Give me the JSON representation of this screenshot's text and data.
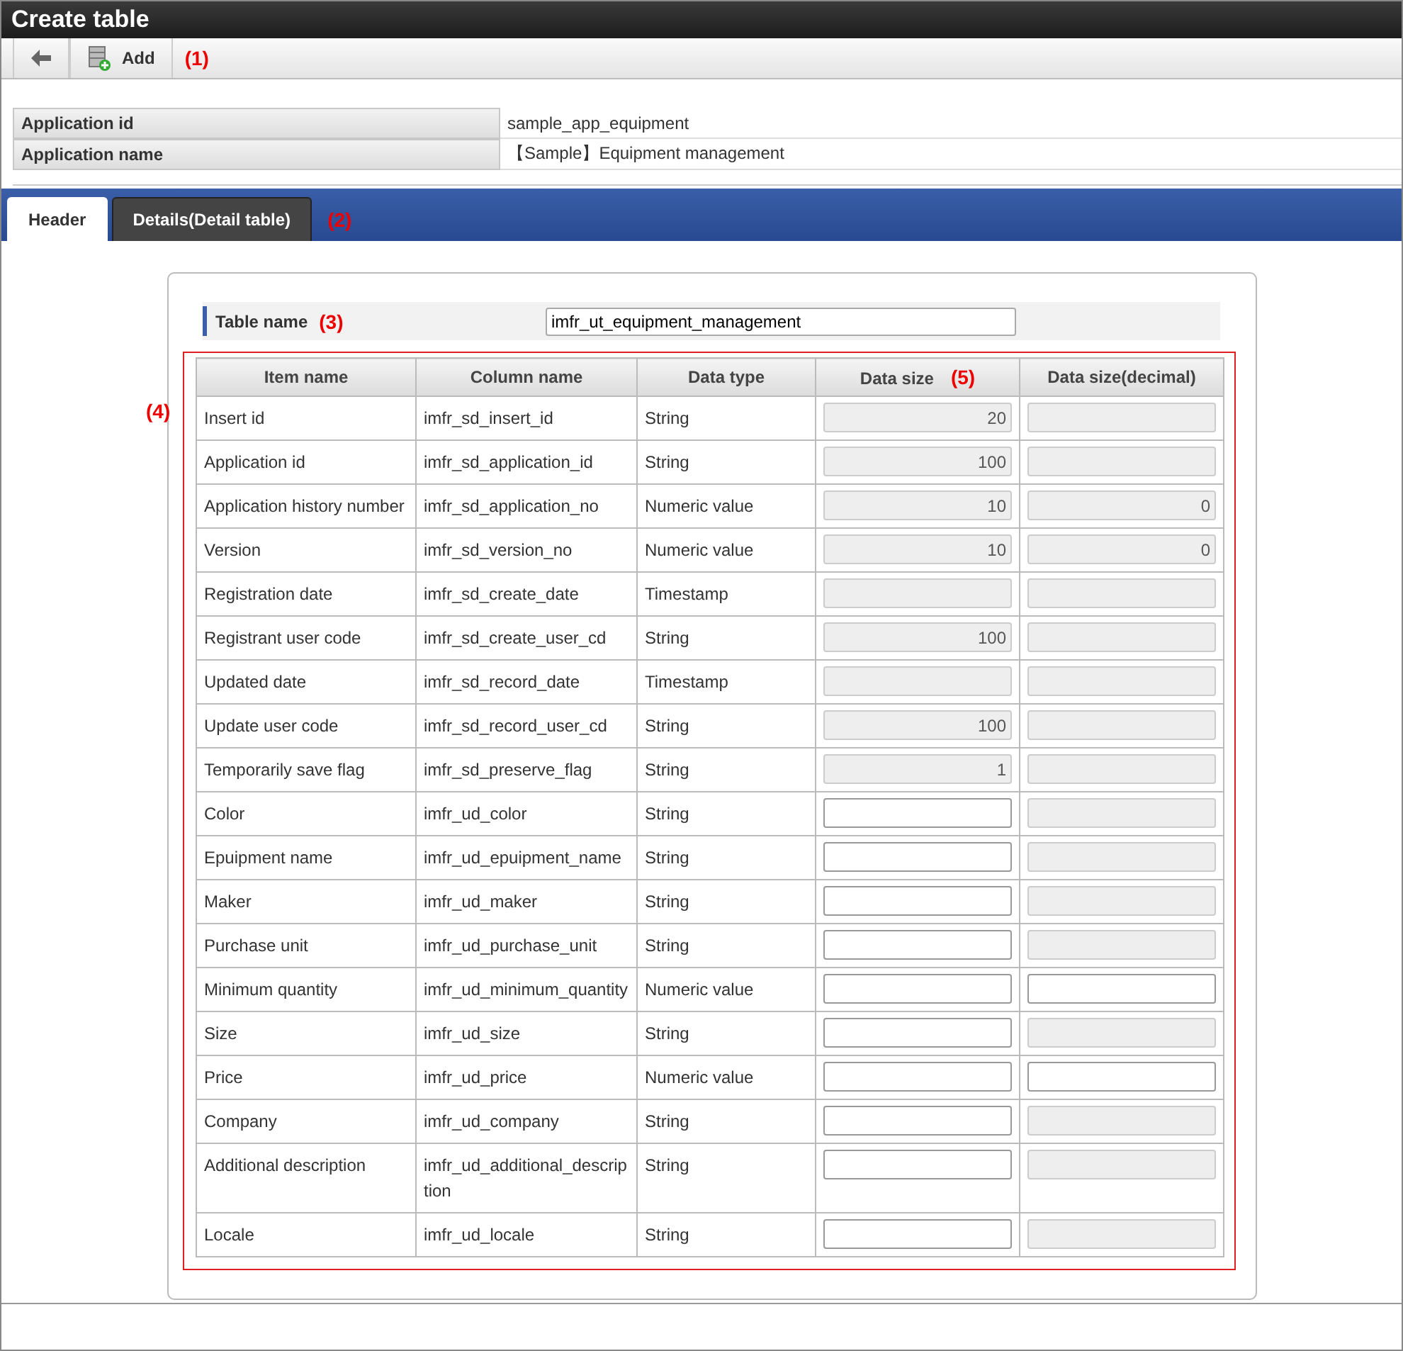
{
  "window": {
    "title": "Create table"
  },
  "toolbar": {
    "buttons": [
      {
        "kind": "back"
      },
      {
        "kind": "add",
        "label": "Add"
      }
    ],
    "annotation": "(1)"
  },
  "app_info": [
    {
      "label": "Application id",
      "value": "sample_app_equipment"
    },
    {
      "label": "Application name",
      "value": "【Sample】Equipment management"
    }
  ],
  "tabs": [
    {
      "label": "Header",
      "selected": true
    },
    {
      "label": "Details(Detail table)",
      "selected": false
    }
  ],
  "tabs_annotation": "(2)",
  "table_name": {
    "label": "Table name",
    "annotation": "(3)",
    "value": "imfr_ut_equipment_management"
  },
  "table_annotation": "(4)",
  "table": {
    "columns": [
      {
        "label": "Item name"
      },
      {
        "label": "Column name"
      },
      {
        "label": "Data type"
      },
      {
        "label": "Data size",
        "annotation": "(5)"
      },
      {
        "label": "Data size(decimal)"
      }
    ],
    "rows": [
      {
        "item": "Insert id",
        "column": "imfr_sd_insert_id",
        "type": "String",
        "size": {
          "value": "20",
          "disabled": true
        },
        "decimal": {
          "disabled": true
        }
      },
      {
        "item": "Application id",
        "column": "imfr_sd_application_id",
        "type": "String",
        "size": {
          "value": "100",
          "disabled": true
        },
        "decimal": {
          "disabled": true
        }
      },
      {
        "item": "Application history number",
        "column": "imfr_sd_application_no",
        "type": "Numeric value",
        "size": {
          "value": "10",
          "disabled": true
        },
        "decimal": {
          "value": "0",
          "disabled": true
        }
      },
      {
        "item": "Version",
        "column": "imfr_sd_version_no",
        "type": "Numeric value",
        "size": {
          "value": "10",
          "disabled": true
        },
        "decimal": {
          "value": "0",
          "disabled": true
        }
      },
      {
        "item": "Registration date",
        "column": "imfr_sd_create_date",
        "type": "Timestamp",
        "size": {
          "disabled": true
        },
        "decimal": {
          "disabled": true
        }
      },
      {
        "item": "Registrant user code",
        "column": "imfr_sd_create_user_cd",
        "type": "String",
        "size": {
          "value": "100",
          "disabled": true
        },
        "decimal": {
          "disabled": true
        }
      },
      {
        "item": "Updated date",
        "column": "imfr_sd_record_date",
        "type": "Timestamp",
        "size": {
          "disabled": true
        },
        "decimal": {
          "disabled": true
        }
      },
      {
        "item": "Update user code",
        "column": "imfr_sd_record_user_cd",
        "type": "String",
        "size": {
          "value": "100",
          "disabled": true
        },
        "decimal": {
          "disabled": true
        }
      },
      {
        "item": "Temporarily save flag",
        "column": "imfr_sd_preserve_flag",
        "type": "String",
        "size": {
          "value": "1",
          "disabled": true
        },
        "decimal": {
          "disabled": true
        }
      },
      {
        "item": "Color",
        "column": "imfr_ud_color",
        "type": "String",
        "size": {
          "disabled": false
        },
        "decimal": {
          "disabled": true
        }
      },
      {
        "item": "Epuipment name",
        "column": "imfr_ud_epuipment_name",
        "type": "String",
        "size": {
          "disabled": false
        },
        "decimal": {
          "disabled": true
        }
      },
      {
        "item": "Maker",
        "column": "imfr_ud_maker",
        "type": "String",
        "size": {
          "disabled": false
        },
        "decimal": {
          "disabled": true
        }
      },
      {
        "item": "Purchase unit",
        "column": "imfr_ud_purchase_unit",
        "type": "String",
        "size": {
          "disabled": false
        },
        "decimal": {
          "disabled": true
        }
      },
      {
        "item": "Minimum quantity",
        "column": "imfr_ud_minimum_quantity",
        "type": "Numeric value",
        "size": {
          "disabled": false
        },
        "decimal": {
          "disabled": false
        }
      },
      {
        "item": "Size",
        "column": "imfr_ud_size",
        "type": "String",
        "size": {
          "disabled": false
        },
        "decimal": {
          "disabled": true
        }
      },
      {
        "item": "Price",
        "column": "imfr_ud_price",
        "type": "Numeric value",
        "size": {
          "disabled": false
        },
        "decimal": {
          "disabled": false
        }
      },
      {
        "item": "Company",
        "column": "imfr_ud_company",
        "type": "String",
        "size": {
          "disabled": false
        },
        "decimal": {
          "disabled": true
        }
      },
      {
        "item": "Additional description",
        "column": "imfr_ud_additional_description",
        "type": "String",
        "size": {
          "disabled": false
        },
        "decimal": {
          "disabled": true
        }
      },
      {
        "item": "Locale",
        "column": "imfr_ud_locale",
        "type": "String",
        "size": {
          "disabled": false
        },
        "decimal": {
          "disabled": true
        }
      }
    ]
  }
}
